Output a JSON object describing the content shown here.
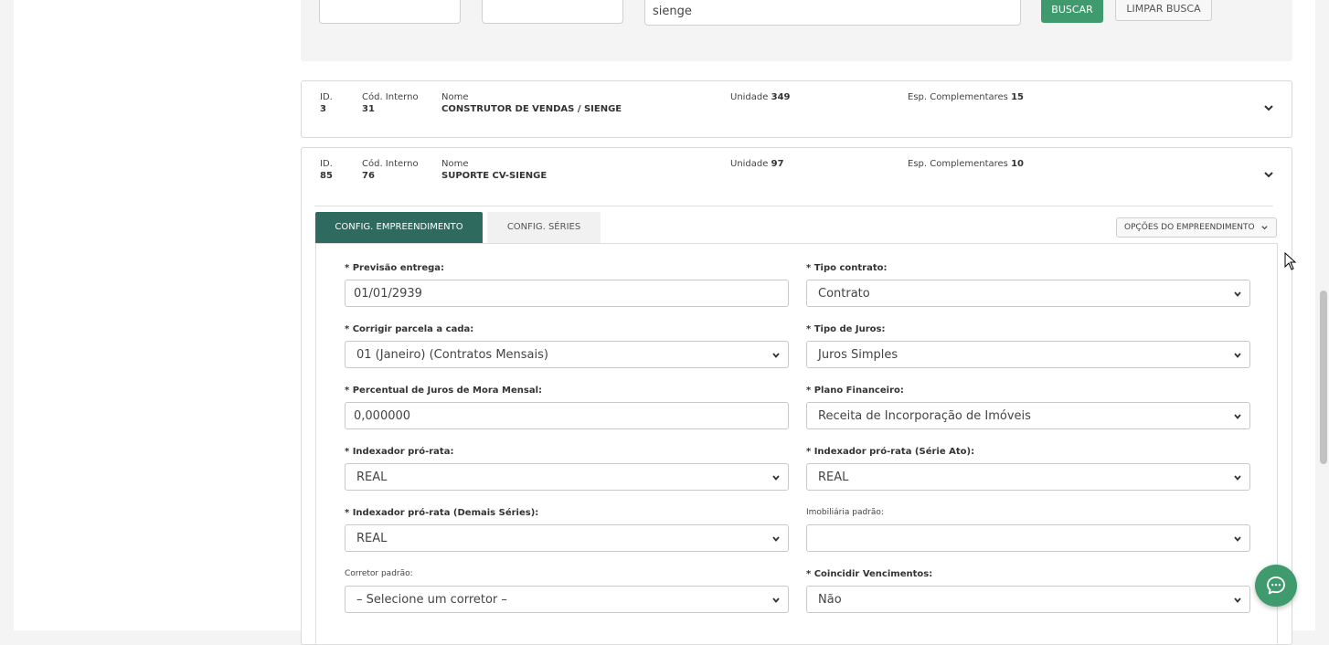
{
  "search": {
    "filter1_value": "",
    "filter2_value": "",
    "query_value": "sienge",
    "buscar_label": "BUSCAR",
    "limpar_label": "LIMPAR BUSCA"
  },
  "cards": [
    {
      "id_label": "ID.",
      "id_value": "3",
      "cod_label": "Cód. Interno",
      "cod_value": "31",
      "nome_label": "Nome",
      "nome_value": "CONSTRUTOR DE VENDAS / SIENGE",
      "unidade_label": "Unidade",
      "unidade_value": "349",
      "esp_label": "Esp. Complementares",
      "esp_value": "15"
    },
    {
      "id_label": "ID.",
      "id_value": "85",
      "cod_label": "Cód. Interno",
      "cod_value": "76",
      "nome_label": "Nome",
      "nome_value": "SUPORTE CV-SIENGE",
      "unidade_label": "Unidade",
      "unidade_value": "97",
      "esp_label": "Esp. Complementares",
      "esp_value": "10"
    }
  ],
  "tabs": {
    "active": "CONFIG. EMPREENDIMENTO",
    "second": "CONFIG. SÉRIES"
  },
  "options_button": "OPÇÕES DO EMPREENDIMENTO",
  "form": {
    "previsao_label": "* Previsão entrega:",
    "previsao_value": "01/01/2939",
    "tipo_contrato_label": "* Tipo contrato:",
    "tipo_contrato_value": "Contrato",
    "corrigir_label": "* Corrigir parcela a cada:",
    "corrigir_value": "01 (Janeiro) (Contratos Mensais)",
    "tipo_juros_label": "* Tipo de Juros:",
    "tipo_juros_value": "Juros Simples",
    "percentual_label": "* Percentual de Juros de Mora Mensal:",
    "percentual_value": "0,000000",
    "plano_label": "* Plano Financeiro:",
    "plano_value": "Receita de Incorporação de Imóveis",
    "indexador_label": "* Indexador pró-rata:",
    "indexador_value": "REAL",
    "indexador_ato_label": "* Indexador pró-rata (Série Ato):",
    "indexador_ato_value": "REAL",
    "indexador_demais_label": "* Indexador pró-rata (Demais Séries):",
    "indexador_demais_value": "REAL",
    "imobiliaria_label": "Imobiliária padrão:",
    "imobiliaria_value": "",
    "corretor_label": "Corretor padrão:",
    "corretor_value": "– Selecione um corretor –",
    "coincidir_label": "* Coincidir Vencimentos:",
    "coincidir_value": "Não"
  },
  "colors": {
    "primary_green": "#3f9b6e",
    "tab_active": "#2e6b5e"
  }
}
